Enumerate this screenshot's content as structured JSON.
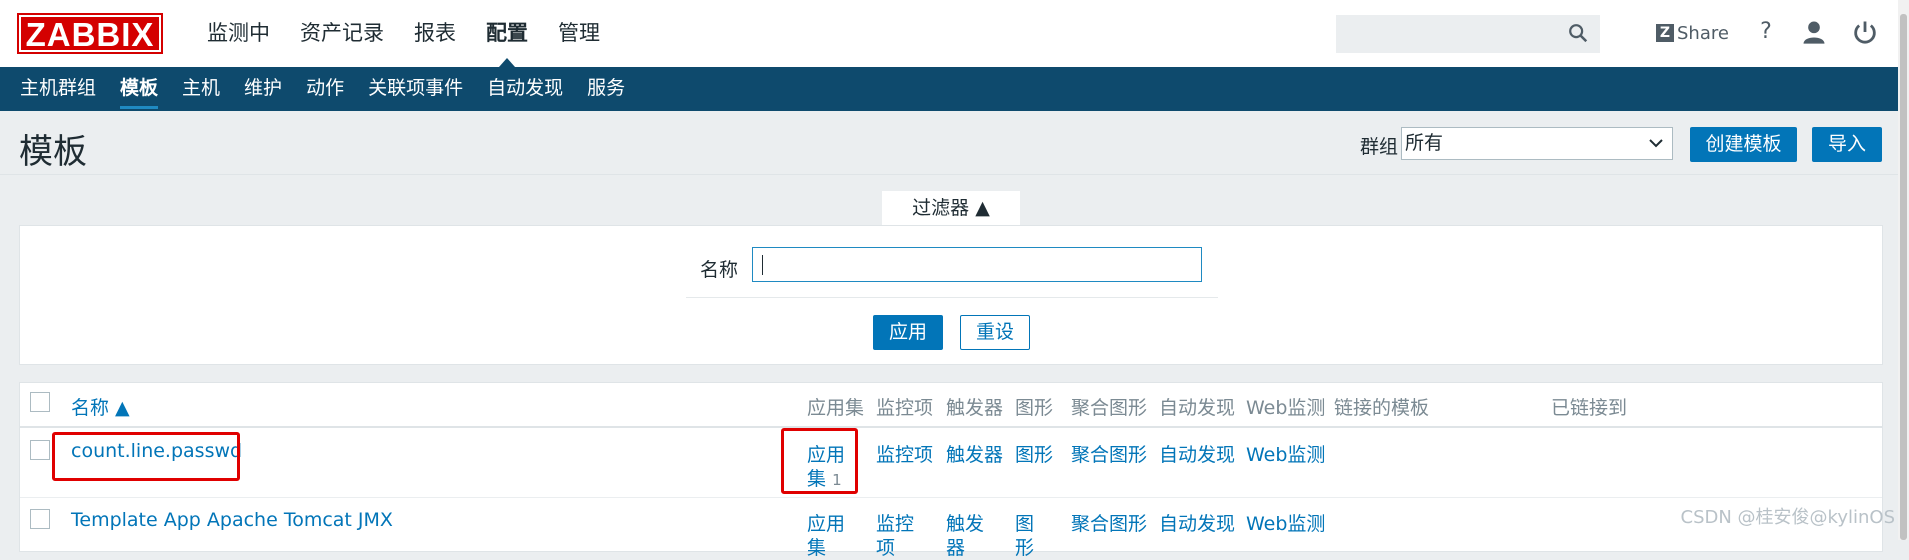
{
  "header": {
    "logo": "ZABBIX",
    "menu": [
      "监测中",
      "资产记录",
      "报表",
      "配置",
      "管理"
    ],
    "active_menu": 3,
    "search_placeholder": "",
    "share_label": "Share",
    "help_label": "?"
  },
  "submenu": {
    "items": [
      "主机群组",
      "模板",
      "主机",
      "维护",
      "动作",
      "关联项事件",
      "自动发现",
      "服务"
    ],
    "active": 1
  },
  "page": {
    "title": "模板",
    "group_label": "群组",
    "group_value": "所有",
    "create_button": "创建模板",
    "import_button": "导入"
  },
  "filter": {
    "tab_label": "过滤器 ▲",
    "name_label": "名称",
    "name_value": "",
    "apply_button": "应用",
    "reset_button": "重设"
  },
  "table": {
    "columns": [
      "名称 ▲",
      "应用集",
      "监控项",
      "触发器",
      "图形",
      "聚合图形",
      "自动发现",
      "Web监测",
      "链接的模板",
      "已链接到"
    ],
    "rows": [
      {
        "name": "count.line.passwd",
        "app_line1": "应用",
        "app_line2": "集",
        "app_count": "1",
        "items": "监控项",
        "triggers": "触发器",
        "graphs": "图形",
        "screens": "聚合图形",
        "discovery": "自动发现",
        "web": "Web监测"
      },
      {
        "name": "Template App Apache Tomcat JMX",
        "app_line1": "应用",
        "app_line2": "集",
        "items": "监控",
        "items2": "项",
        "triggers": "触发",
        "triggers2": "器",
        "graphs": "图",
        "graphs2": "形",
        "screens": "聚合图形",
        "discovery": "自动发现",
        "web": "Web监测"
      }
    ]
  },
  "watermark": "CSDN @桂安俊@kylinOS",
  "colors": {
    "brand_red": "#d40000",
    "nav_blue": "#0e4a6d",
    "link_blue": "#0275b8",
    "highlight_red": "#e00000"
  }
}
